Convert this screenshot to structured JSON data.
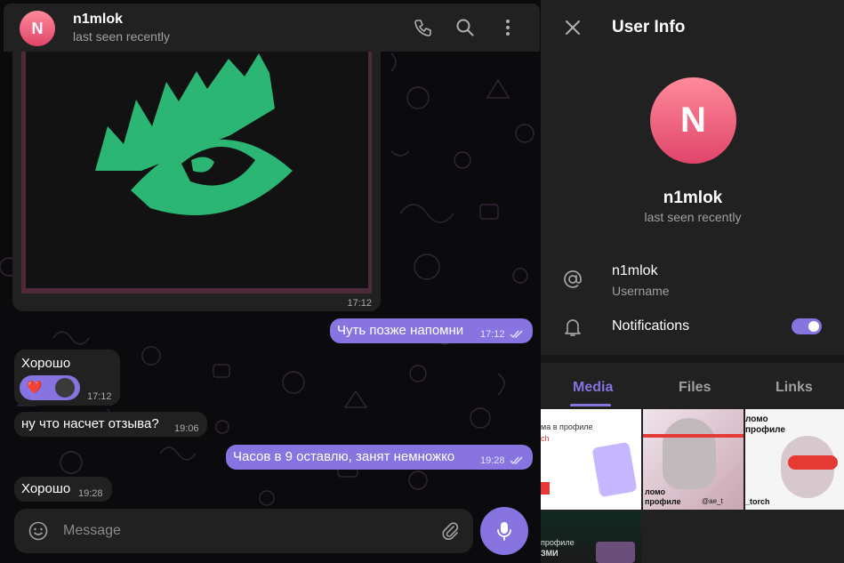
{
  "chat": {
    "header": {
      "avatar_letter": "N",
      "name": "n1mlok",
      "status": "last seen recently",
      "icons": [
        "phone-icon",
        "search-icon",
        "more-vertical-icon"
      ]
    },
    "image_message": {
      "time": "17:12"
    },
    "messages": [
      {
        "id": "m1",
        "direction": "out",
        "text": "Чуть позже напомни",
        "time": "17:12",
        "read": true
      },
      {
        "id": "m2",
        "direction": "in",
        "text": "Хорошо",
        "time": "17:12",
        "reactions": [
          "❤️",
          "avatar"
        ]
      },
      {
        "id": "m3",
        "direction": "in",
        "text": "ну что насчет отзыва?",
        "time": "19:06"
      },
      {
        "id": "m4",
        "direction": "out",
        "text": "Часов в 9 оставлю, занят немножко",
        "time": "19:28",
        "read": true
      },
      {
        "id": "m5",
        "direction": "in",
        "text": "Хорошо",
        "time": "19:28"
      }
    ],
    "composer": {
      "placeholder": "Message"
    }
  },
  "info_panel": {
    "title": "User Info",
    "avatar_letter": "N",
    "name": "n1mlok",
    "status": "last seen recently",
    "username_value": "n1mlok",
    "username_label": "Username",
    "notifications_label": "Notifications",
    "notifications_enabled": true,
    "tabs": [
      "Media",
      "Files",
      "Links"
    ],
    "active_tab": "Media",
    "media": [
      {
        "text_1": "ма в профиле",
        "text_2": "ch"
      },
      {
        "text_1": "ломо",
        "text_2": "профиле",
        "text_3": "@ae_t"
      },
      {
        "text_1": "ломо",
        "text_2": "профиле",
        "text_3": "_torch"
      },
      {
        "text_1": "профиле",
        "text_2": "ЗМИ"
      }
    ]
  },
  "colors": {
    "accent": "#8774e1",
    "background": "#0b0b0d",
    "surface": "#212121",
    "avatar_gradient_top": "#ff8a9a",
    "avatar_gradient_bottom": "#e0456a",
    "eye_logo_green": "#2bb673"
  }
}
